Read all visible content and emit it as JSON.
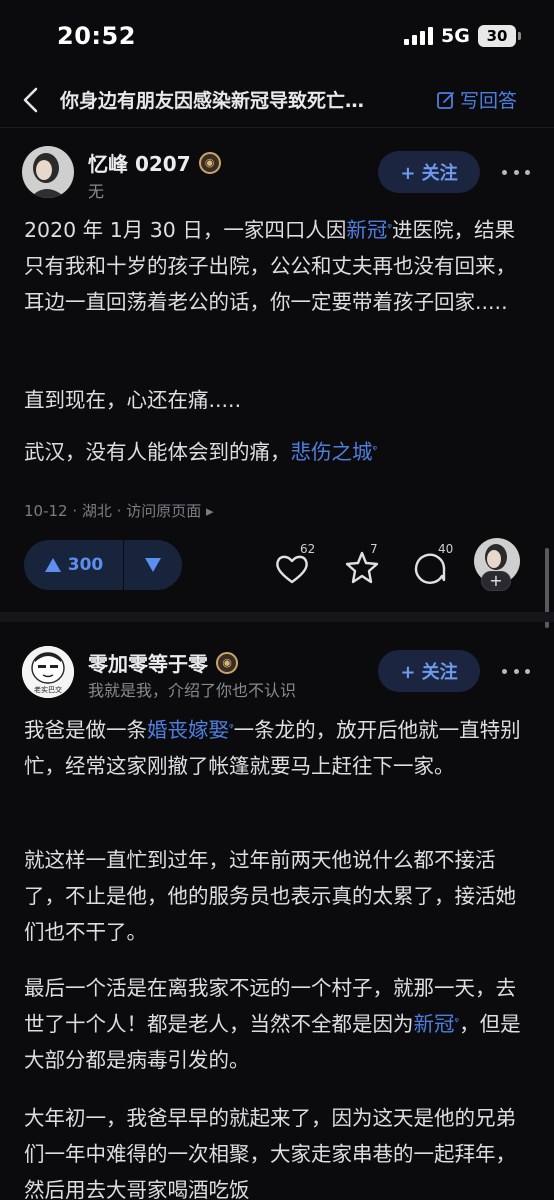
{
  "status_bar": {
    "time": "20:52",
    "network": "5G",
    "battery": "30"
  },
  "nav": {
    "title": "你身边有朋友因感染新冠导致死亡…",
    "write_answer": "写回答"
  },
  "answers": [
    {
      "author": "忆峰 0207",
      "bio": "无",
      "follow_label": "+ 关注",
      "paragraphs": [
        [
          "2020 年 1月 30 日，一家四口人因",
          "新冠",
          "进医院，结果只有我和十岁的孩子出院，公公和丈夫再也没有回来，耳边一直回荡着老公的话，你一定要带着孩子回家....."
        ],
        [
          "直到现在，心还在痛.....",
          "",
          ""
        ],
        [
          "武汉，没有人能体会到的痛，",
          "悲伤之城",
          ""
        ]
      ],
      "meta": "10-12 · 湖北 · 访问原页面 ▸",
      "votes": "300",
      "likes": "62",
      "favorites": "7",
      "comments": "40"
    },
    {
      "author": "零加零等于零",
      "avatar_text": "老实巴交",
      "bio": "我就是我，介绍了你也不认识",
      "follow_label": "+ 关注",
      "paragraphs": [
        [
          "我爸是做一条",
          "婚丧嫁娶",
          "一条龙的，放开后他就一直特别忙，经常这家刚撤了帐篷就要马上赶往下一家。"
        ],
        [
          "就这样一直忙到过年，过年前两天他说什么都不接活了，不止是他，他的服务员也表示真的太累了，接活她们也不干了。",
          "",
          ""
        ],
        [
          "最后一个活是在离我家不远的一个村子，就那一天，去世了十个人！都是老人，当然不全都是因为",
          "新冠",
          "，但是大部分都是病毒引发的。"
        ],
        [
          "大年初一，我爸早早的就起来了，因为这天是他的兄弟们一年中难得的一次相聚，大家走家串巷的一起拜年，然后用去大哥家喝酒吃饭",
          "",
          ""
        ]
      ]
    }
  ],
  "colors": {
    "background": "#0b0b0d",
    "accent": "#4e7fe0",
    "text": "#dedee0",
    "muted": "#7d7d82"
  },
  "icons": [
    "back-icon",
    "edit-icon",
    "signal-icon",
    "eye-badge-icon",
    "more-icon",
    "upvote-icon",
    "downvote-icon",
    "heart-icon",
    "star-icon",
    "comment-icon",
    "search-glyph-icon"
  ]
}
